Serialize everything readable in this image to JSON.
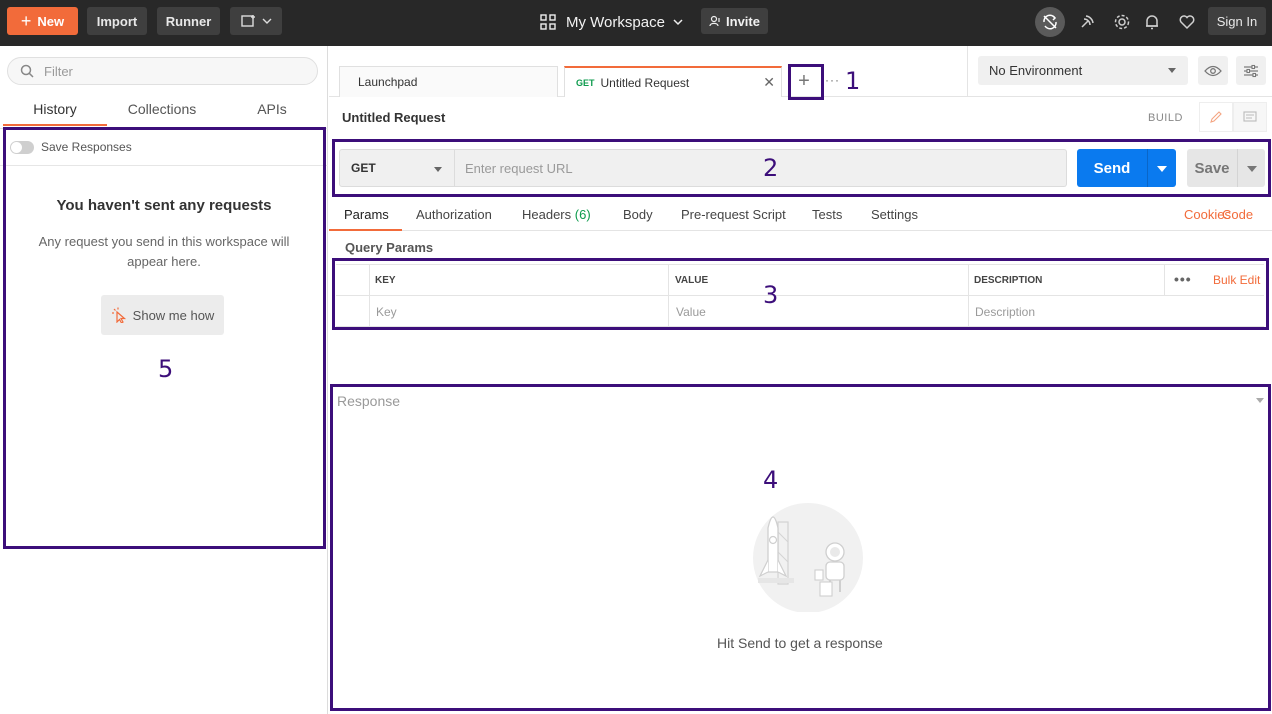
{
  "topbar": {
    "new_label": "New",
    "import_label": "Import",
    "runner_label": "Runner",
    "workspace_label": "My Workspace",
    "invite_label": "Invite",
    "signin_label": "Sign In",
    "colors": {
      "bar": "#282828",
      "new_button": "#f26b3a"
    }
  },
  "sidebar": {
    "filter_placeholder": "Filter",
    "tabs": [
      {
        "label": "History",
        "active": true
      },
      {
        "label": "Collections",
        "active": false
      },
      {
        "label": "APIs",
        "active": false
      }
    ],
    "save_responses_label": "Save Responses",
    "empty_title": "You haven't sent any requests",
    "empty_desc": "Any request you send in this workspace will appear here.",
    "show_me_label": "Show me how"
  },
  "tabs": {
    "items": [
      {
        "label": "Launchpad"
      },
      {
        "method": "GET",
        "label": "Untitled Request",
        "active": true
      }
    ],
    "more_label": "···"
  },
  "environment": {
    "selected": "No Environment"
  },
  "request": {
    "title": "Untitled Request",
    "build_label": "BUILD",
    "method": "GET",
    "url_placeholder": "Enter request URL",
    "send_label": "Send",
    "save_label": "Save",
    "tabs": [
      {
        "label": "Params",
        "active": true
      },
      {
        "label": "Authorization"
      },
      {
        "label": "Headers",
        "count": "(6)"
      },
      {
        "label": "Body"
      },
      {
        "label": "Pre-request Script"
      },
      {
        "label": "Tests"
      },
      {
        "label": "Settings"
      }
    ],
    "links": {
      "cookies": "Cookies",
      "code": "Code"
    },
    "query_params_label": "Query Params",
    "table": {
      "headers": [
        "KEY",
        "VALUE",
        "DESCRIPTION"
      ],
      "placeholders": [
        "Key",
        "Value",
        "Description"
      ],
      "bulk_edit_label": "Bulk Edit",
      "more_label": "•••"
    }
  },
  "response": {
    "label": "Response",
    "empty_text": "Hit Send to get a response"
  },
  "annotations": {
    "color": "#3c0e7a",
    "labels": [
      "1",
      "2",
      "3",
      "4",
      "5"
    ]
  }
}
